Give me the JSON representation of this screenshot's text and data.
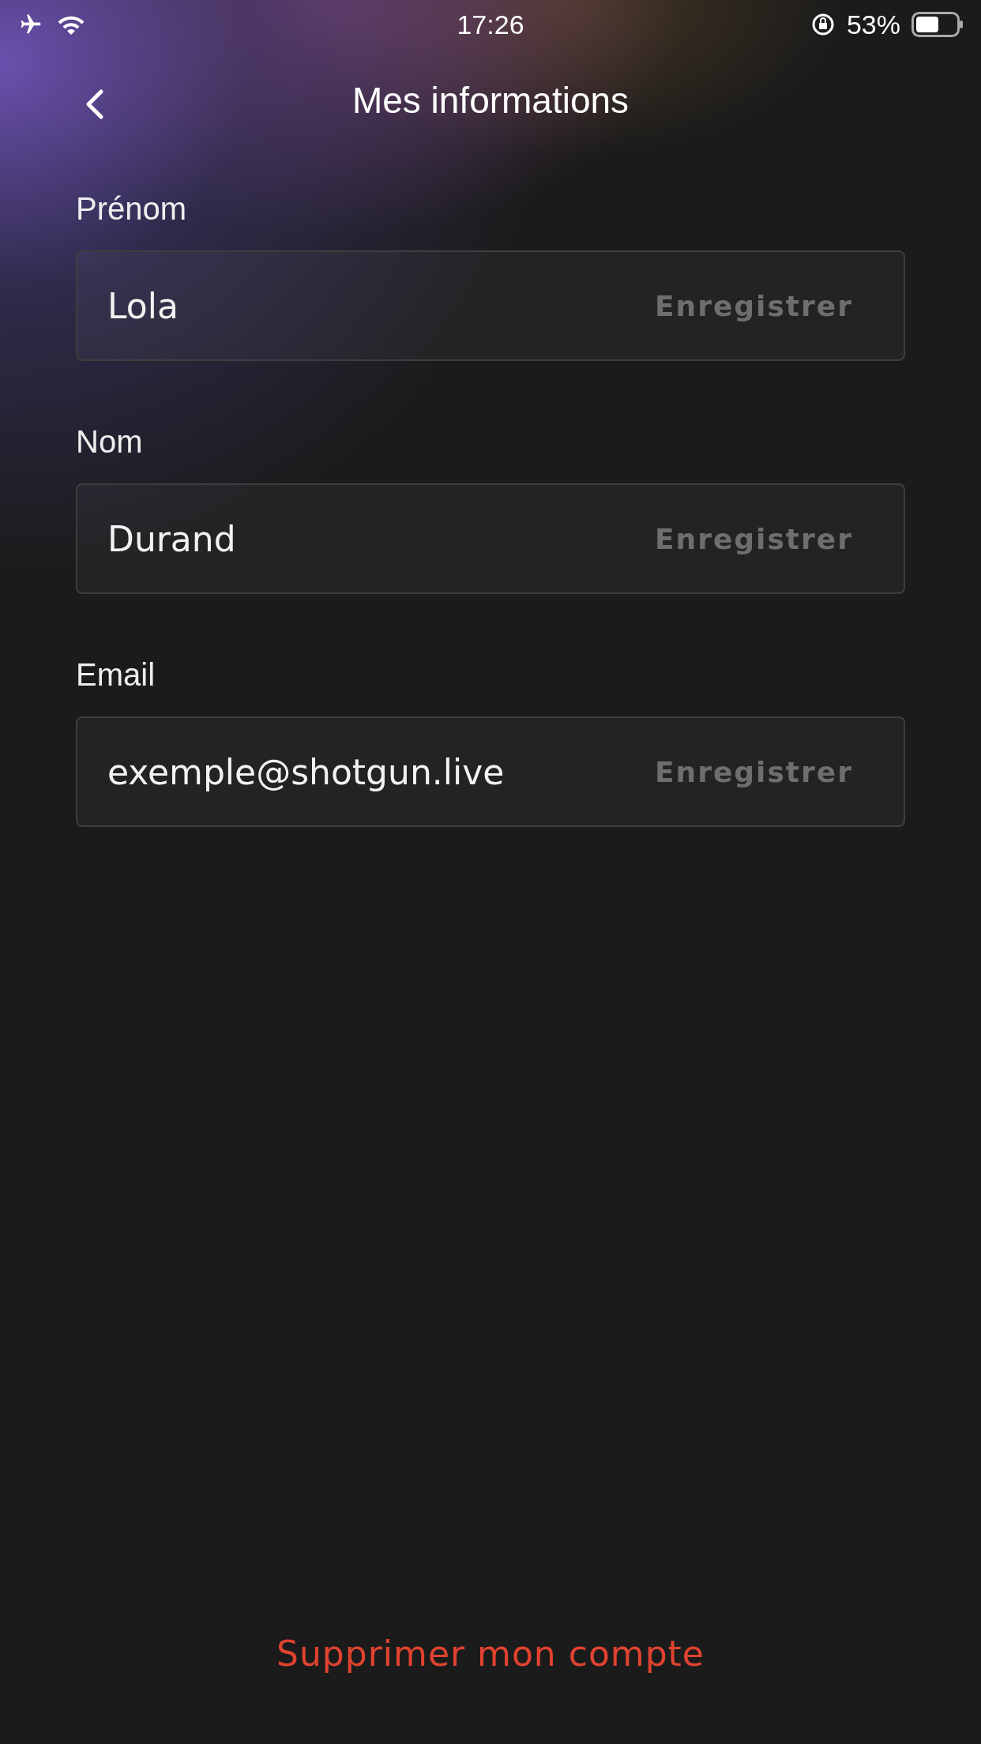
{
  "status_bar": {
    "time": "17:26",
    "battery": "53%"
  },
  "header": {
    "title": "Mes informations"
  },
  "fields": [
    {
      "label": "Prénom",
      "value": "Lola",
      "action": "Enregistrer",
      "disabled": true
    },
    {
      "label": "Nom",
      "value": "Durand",
      "action": "Enregistrer",
      "disabled": true
    },
    {
      "label": "Email",
      "value": "exemple@shotgun.live",
      "action": "Enregistrer",
      "disabled": true
    }
  ],
  "delete_link": "Supprimer mon compte"
}
